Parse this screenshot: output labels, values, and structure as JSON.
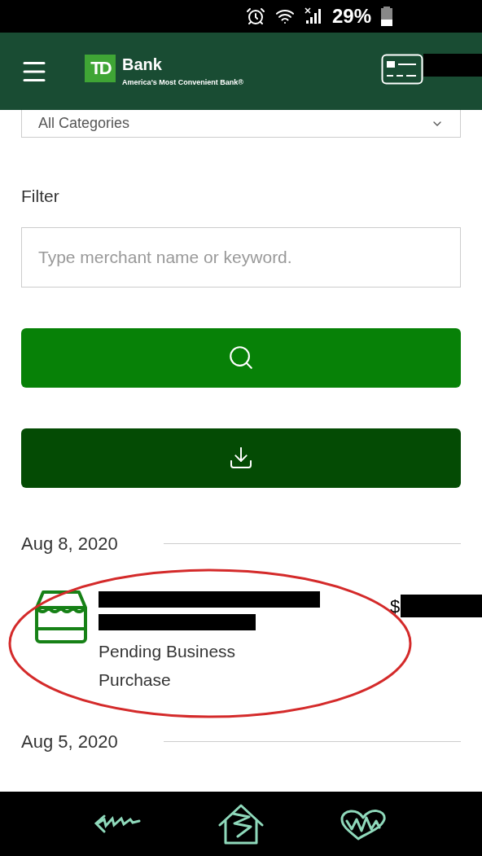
{
  "status_bar": {
    "battery": "29%"
  },
  "header": {
    "brand": "Bank",
    "logo_mark": "TD",
    "tagline": "America’s Most Convenient Bank®"
  },
  "category_select": {
    "value": "All Categories"
  },
  "filter": {
    "label": "Filter",
    "placeholder": "Type merchant name or keyword."
  },
  "groups": [
    {
      "date": "Aug 8, 2020",
      "transactions": [
        {
          "amount_prefix": "$",
          "description": "Pending Business Purchase"
        }
      ]
    },
    {
      "date": "Aug 5, 2020"
    }
  ]
}
